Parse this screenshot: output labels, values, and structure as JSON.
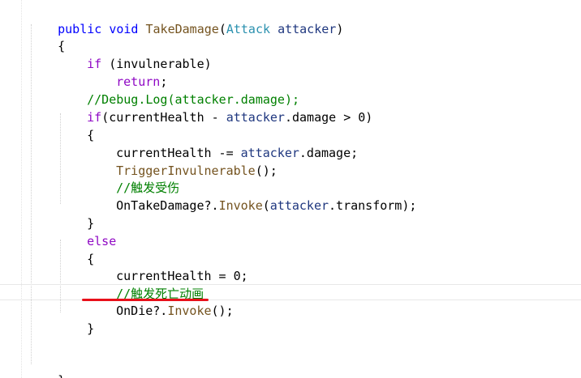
{
  "code": {
    "l1": {
      "kw1": "public",
      "kw2": "void",
      "method": "TakeDamage",
      "p1": "(",
      "type": "Attack",
      "param": "attacker",
      "p2": ")"
    },
    "l2": {
      "text": "{"
    },
    "l3": {
      "ctl": "if",
      "text": " (invulnerable)"
    },
    "l4": {
      "ctl": "return",
      "text": ";"
    },
    "l5": {
      "comment": "//Debug.Log(attacker.damage);"
    },
    "l6": {
      "ctl": "if",
      "p1": "(currentHealth - ",
      "param": "attacker",
      "p2": ".damage > 0)"
    },
    "l7": {
      "text": "{"
    },
    "l8": {
      "p1": "currentHealth -= ",
      "param": "attacker",
      "p2": ".damage;"
    },
    "l9": {
      "method": "TriggerInvulnerable",
      "text": "();"
    },
    "l10": {
      "comment": "//触发受伤"
    },
    "l11": {
      "p1": "OnTakeDamage?.",
      "method": "Invoke",
      "p2": "(",
      "param": "attacker",
      "p3": ".transform);"
    },
    "l12": {
      "text": "}"
    },
    "l13": {
      "ctl": "else"
    },
    "l14": {
      "text": "{"
    },
    "l15": {
      "text": "currentHealth = 0;"
    },
    "l16": {
      "comment": "//触发死亡动画"
    },
    "l17": {
      "p1": "OnDie?.",
      "method": "Invoke",
      "p2": "();"
    },
    "l18": {
      "text": "}"
    },
    "l19": {
      "text": "}"
    }
  },
  "annotation": {
    "underline_color": "#e8101a"
  },
  "colors": {
    "keyword": "#0000ff",
    "control": "#8f08c4",
    "type": "#2b91af",
    "method": "#74531f",
    "parameter": "#1f377f",
    "comment": "#008000"
  }
}
